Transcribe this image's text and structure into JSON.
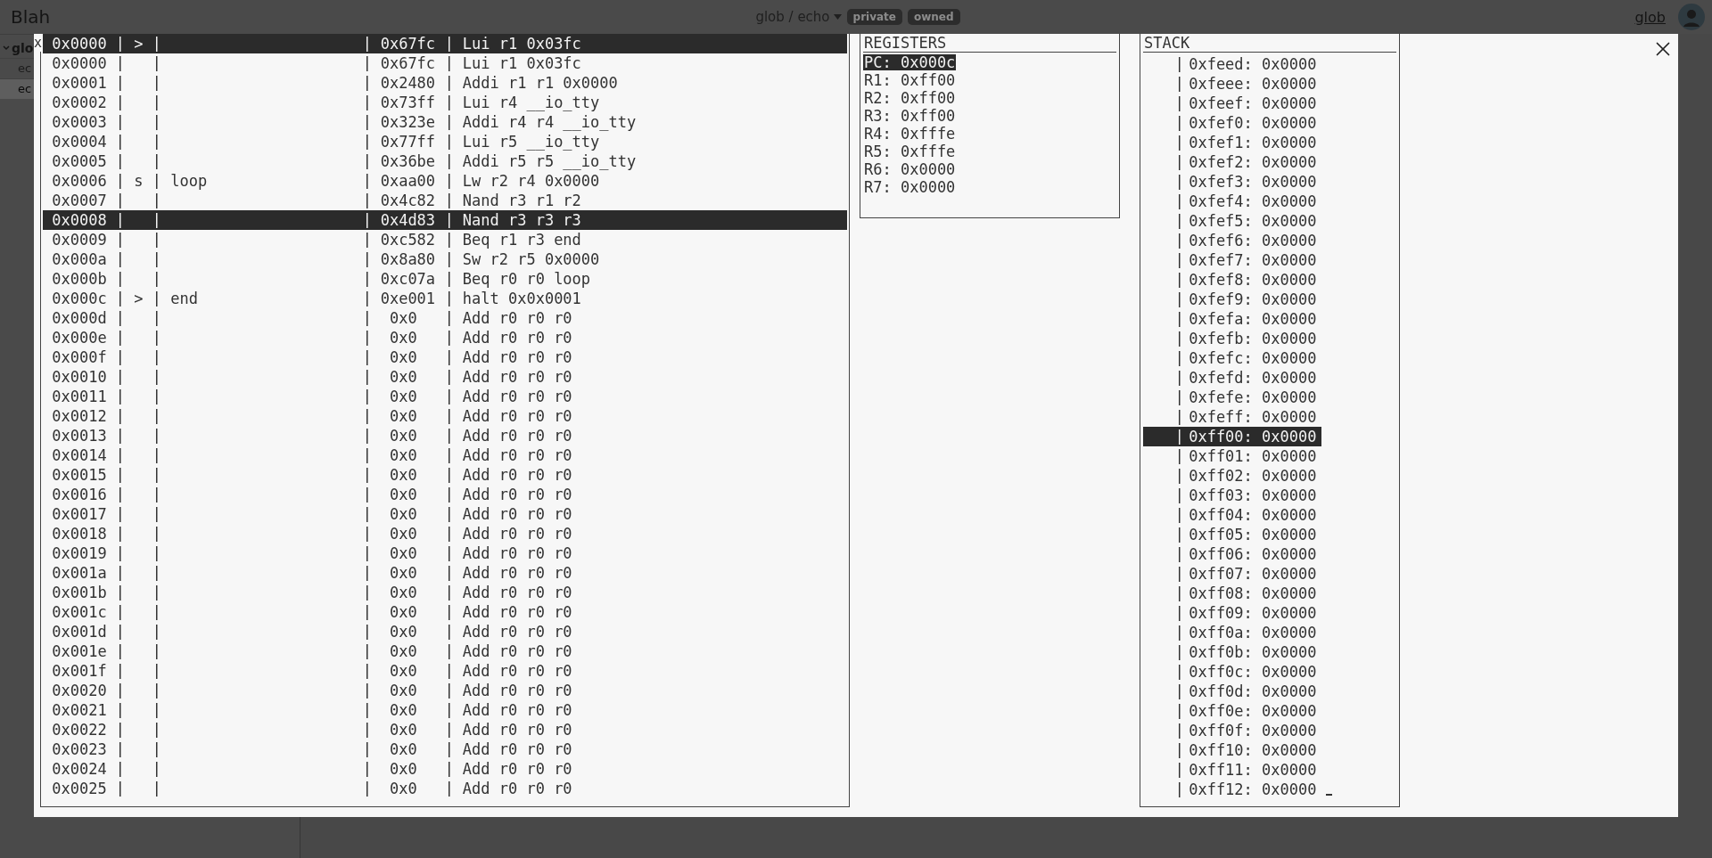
{
  "header": {
    "title": "Blah",
    "repo": "glob / echo",
    "badges": [
      "private",
      "owned"
    ],
    "user": "glob"
  },
  "sidebar": {
    "group": "glo",
    "items": [
      {
        "label": "ec",
        "selected": false
      },
      {
        "label": "ec",
        "selected": true
      }
    ]
  },
  "debugger": {
    "close_mark": "x",
    "program": {
      "rows": [
        {
          "address": "0x0000",
          "marker": ">",
          "word": "0x67fc",
          "instruction": "Lui r1 0x03fc",
          "selected": true
        },
        {
          "address": "0x0000",
          "word": "0x67fc",
          "instruction": "Lui r1 0x03fc",
          "selected": false
        },
        {
          "address": "0x0001",
          "word": "0x2480",
          "instruction": "Addi r1 r1 0x0000",
          "selected": false
        },
        {
          "address": "0x0002",
          "word": "0x73ff",
          "instruction": "Lui r4 __io_tty",
          "selected": false
        },
        {
          "address": "0x0003",
          "word": "0x323e",
          "instruction": "Addi r4 r4 __io_tty",
          "selected": false
        },
        {
          "address": "0x0004",
          "word": "0x77ff",
          "instruction": "Lui r5 __io_tty",
          "selected": false
        },
        {
          "address": "0x0005",
          "word": "0x36be",
          "instruction": "Addi r5 r5 __io_tty",
          "selected": false
        },
        {
          "address": "0x0006",
          "marker": "s",
          "label": "loop",
          "word": "0xaa00",
          "instruction": "Lw r2 r4 0x0000",
          "selected": false
        },
        {
          "address": "0x0007",
          "word": "0x4c82",
          "instruction": "Nand r3 r1 r2",
          "selected": false
        },
        {
          "address": "0x0008",
          "word": "0x4d83",
          "instruction": "Nand r3 r3 r3",
          "selected": true
        },
        {
          "address": "0x0009",
          "word": "0xc582",
          "instruction": "Beq r1 r3 end",
          "selected": false
        },
        {
          "address": "0x000a",
          "word": "0x8a80",
          "instruction": "Sw r2 r5 0x0000",
          "selected": false
        },
        {
          "address": "0x000b",
          "word": "0xc07a",
          "instruction": "Beq r0 r0 loop",
          "selected": false
        },
        {
          "address": "0x000c",
          "marker": ">",
          "label": "end",
          "word": "0xe001",
          "instruction": "halt 0x0x0001",
          "selected": false
        },
        {
          "address": "0x000d",
          "word": "0x0",
          "instruction": "Add r0 r0 r0",
          "selected": false
        },
        {
          "address": "0x000e",
          "word": "0x0",
          "instruction": "Add r0 r0 r0",
          "selected": false
        },
        {
          "address": "0x000f",
          "word": "0x0",
          "instruction": "Add r0 r0 r0",
          "selected": false
        },
        {
          "address": "0x0010",
          "word": "0x0",
          "instruction": "Add r0 r0 r0",
          "selected": false
        },
        {
          "address": "0x0011",
          "word": "0x0",
          "instruction": "Add r0 r0 r0",
          "selected": false
        },
        {
          "address": "0x0012",
          "word": "0x0",
          "instruction": "Add r0 r0 r0",
          "selected": false
        },
        {
          "address": "0x0013",
          "word": "0x0",
          "instruction": "Add r0 r0 r0",
          "selected": false
        },
        {
          "address": "0x0014",
          "word": "0x0",
          "instruction": "Add r0 r0 r0",
          "selected": false
        },
        {
          "address": "0x0015",
          "word": "0x0",
          "instruction": "Add r0 r0 r0",
          "selected": false
        },
        {
          "address": "0x0016",
          "word": "0x0",
          "instruction": "Add r0 r0 r0",
          "selected": false
        },
        {
          "address": "0x0017",
          "word": "0x0",
          "instruction": "Add r0 r0 r0",
          "selected": false
        },
        {
          "address": "0x0018",
          "word": "0x0",
          "instruction": "Add r0 r0 r0",
          "selected": false
        },
        {
          "address": "0x0019",
          "word": "0x0",
          "instruction": "Add r0 r0 r0",
          "selected": false
        },
        {
          "address": "0x001a",
          "word": "0x0",
          "instruction": "Add r0 r0 r0",
          "selected": false
        },
        {
          "address": "0x001b",
          "word": "0x0",
          "instruction": "Add r0 r0 r0",
          "selected": false
        },
        {
          "address": "0x001c",
          "word": "0x0",
          "instruction": "Add r0 r0 r0",
          "selected": false
        },
        {
          "address": "0x001d",
          "word": "0x0",
          "instruction": "Add r0 r0 r0",
          "selected": false
        },
        {
          "address": "0x001e",
          "word": "0x0",
          "instruction": "Add r0 r0 r0",
          "selected": false
        },
        {
          "address": "0x001f",
          "word": "0x0",
          "instruction": "Add r0 r0 r0",
          "selected": false
        },
        {
          "address": "0x0020",
          "word": "0x0",
          "instruction": "Add r0 r0 r0",
          "selected": false
        },
        {
          "address": "0x0021",
          "word": "0x0",
          "instruction": "Add r0 r0 r0",
          "selected": false
        },
        {
          "address": "0x0022",
          "word": "0x0",
          "instruction": "Add r0 r0 r0",
          "selected": false
        },
        {
          "address": "0x0023",
          "word": "0x0",
          "instruction": "Add r0 r0 r0",
          "selected": false
        },
        {
          "address": "0x0024",
          "word": "0x0",
          "instruction": "Add r0 r0 r0",
          "selected": false
        },
        {
          "address": "0x0025",
          "word": "0x0",
          "instruction": "Add r0 r0 r0",
          "selected": false
        }
      ]
    },
    "registers": {
      "title": "REGISTERS",
      "rows": [
        {
          "text": "PC: 0x000c",
          "selected": true
        },
        {
          "text": "R1: 0xff00",
          "selected": false
        },
        {
          "text": "R2: 0xff00",
          "selected": false
        },
        {
          "text": "R3: 0xff00",
          "selected": false
        },
        {
          "text": "R4: 0xfffe",
          "selected": false
        },
        {
          "text": "R5: 0xfffe",
          "selected": false
        },
        {
          "text": "R6: 0x0000",
          "selected": false
        },
        {
          "text": "R7: 0x0000",
          "selected": false
        }
      ]
    },
    "stack": {
      "title": "STACK",
      "cursor": true,
      "rows": [
        {
          "text": "0xfeed: 0x0000",
          "selected": false
        },
        {
          "text": "0xfeee: 0x0000",
          "selected": false
        },
        {
          "text": "0xfeef: 0x0000",
          "selected": false
        },
        {
          "text": "0xfef0: 0x0000",
          "selected": false
        },
        {
          "text": "0xfef1: 0x0000",
          "selected": false
        },
        {
          "text": "0xfef2: 0x0000",
          "selected": false
        },
        {
          "text": "0xfef3: 0x0000",
          "selected": false
        },
        {
          "text": "0xfef4: 0x0000",
          "selected": false
        },
        {
          "text": "0xfef5: 0x0000",
          "selected": false
        },
        {
          "text": "0xfef6: 0x0000",
          "selected": false
        },
        {
          "text": "0xfef7: 0x0000",
          "selected": false
        },
        {
          "text": "0xfef8: 0x0000",
          "selected": false
        },
        {
          "text": "0xfef9: 0x0000",
          "selected": false
        },
        {
          "text": "0xfefa: 0x0000",
          "selected": false
        },
        {
          "text": "0xfefb: 0x0000",
          "selected": false
        },
        {
          "text": "0xfefc: 0x0000",
          "selected": false
        },
        {
          "text": "0xfefd: 0x0000",
          "selected": false
        },
        {
          "text": "0xfefe: 0x0000",
          "selected": false
        },
        {
          "text": "0xfeff: 0x0000",
          "selected": false
        },
        {
          "text": "0xff00: 0x0000",
          "selected": true
        },
        {
          "text": "0xff01: 0x0000",
          "selected": false
        },
        {
          "text": "0xff02: 0x0000",
          "selected": false
        },
        {
          "text": "0xff03: 0x0000",
          "selected": false
        },
        {
          "text": "0xff04: 0x0000",
          "selected": false
        },
        {
          "text": "0xff05: 0x0000",
          "selected": false
        },
        {
          "text": "0xff06: 0x0000",
          "selected": false
        },
        {
          "text": "0xff07: 0x0000",
          "selected": false
        },
        {
          "text": "0xff08: 0x0000",
          "selected": false
        },
        {
          "text": "0xff09: 0x0000",
          "selected": false
        },
        {
          "text": "0xff0a: 0x0000",
          "selected": false
        },
        {
          "text": "0xff0b: 0x0000",
          "selected": false
        },
        {
          "text": "0xff0c: 0x0000",
          "selected": false
        },
        {
          "text": "0xff0d: 0x0000",
          "selected": false
        },
        {
          "text": "0xff0e: 0x0000",
          "selected": false
        },
        {
          "text": "0xff0f: 0x0000",
          "selected": false
        },
        {
          "text": "0xff10: 0x0000",
          "selected": false
        },
        {
          "text": "0xff11: 0x0000",
          "selected": false
        },
        {
          "text": "0xff12: 0x0000",
          "selected": false
        }
      ]
    }
  }
}
